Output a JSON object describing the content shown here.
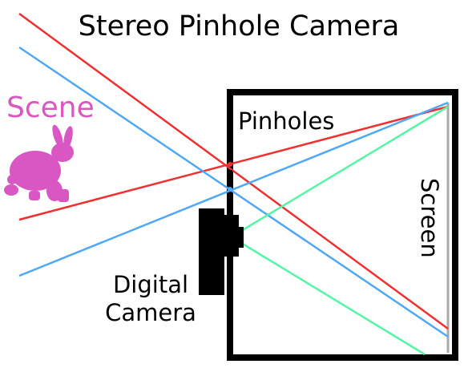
{
  "title": "Stereo Pinhole Camera",
  "labels": {
    "scene": "Scene",
    "pinholes": "Pinholes",
    "screen": "Screen",
    "camera_line1": "Digital",
    "camera_line2": "Camera"
  },
  "colors": {
    "red_ray": "#f03030",
    "blue_ray": "#4fa8f5",
    "green_ray": "#55f5a5",
    "scene": "#d957c2",
    "box": "#000000",
    "screen_plane": "#aaaaaa"
  },
  "icons": {
    "scene_subject": "rabbit-icon",
    "camera": "digital-camera-icon"
  }
}
